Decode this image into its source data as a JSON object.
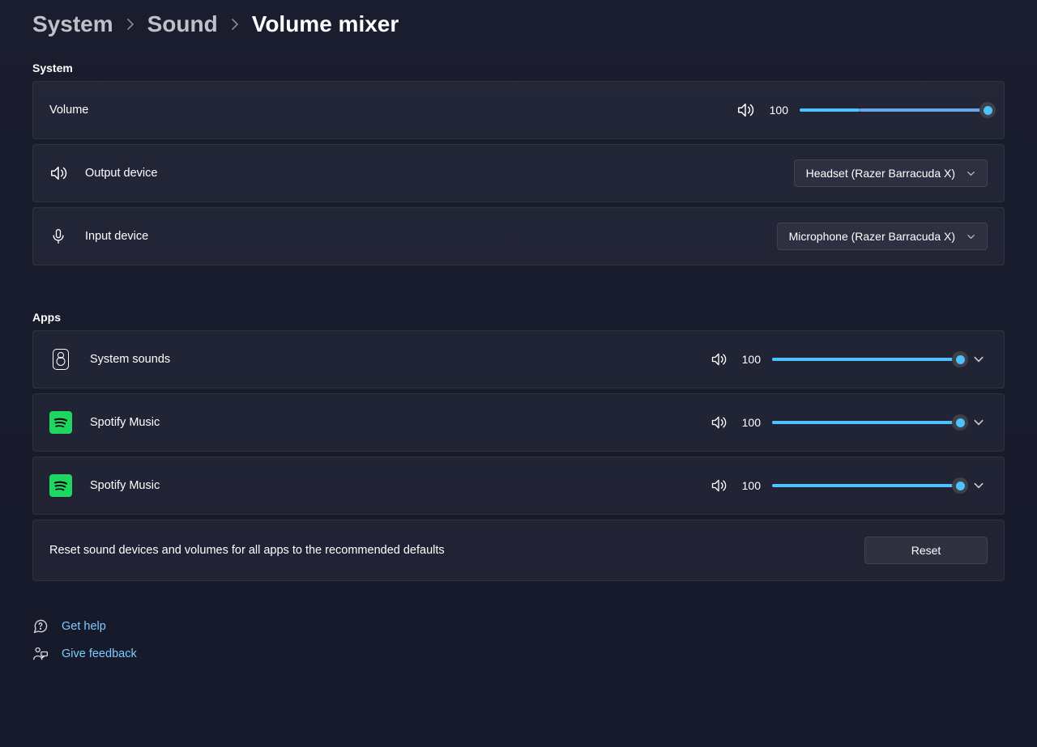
{
  "breadcrumb": {
    "level1": "System",
    "level2": "Sound",
    "current": "Volume mixer"
  },
  "sections": {
    "system_title": "System",
    "apps_title": "Apps"
  },
  "system": {
    "volume": {
      "label": "Volume",
      "value": "100",
      "percent": 100,
      "fill1_percent": 32
    },
    "output": {
      "label": "Output device",
      "selected": "Headset (Razer Barracuda X)"
    },
    "input": {
      "label": "Input device",
      "selected": "Microphone (Razer Barracuda X)"
    }
  },
  "apps": [
    {
      "icon": "system-sounds",
      "label": "System sounds",
      "value": "100",
      "percent": 100
    },
    {
      "icon": "spotify",
      "label": "Spotify Music",
      "value": "100",
      "percent": 100
    },
    {
      "icon": "spotify",
      "label": "Spotify Music",
      "value": "100",
      "percent": 100
    }
  ],
  "reset": {
    "description": "Reset sound devices and volumes for all apps to the recommended defaults",
    "button": "Reset"
  },
  "footer": {
    "help": "Get help",
    "feedback": "Give feedback"
  }
}
